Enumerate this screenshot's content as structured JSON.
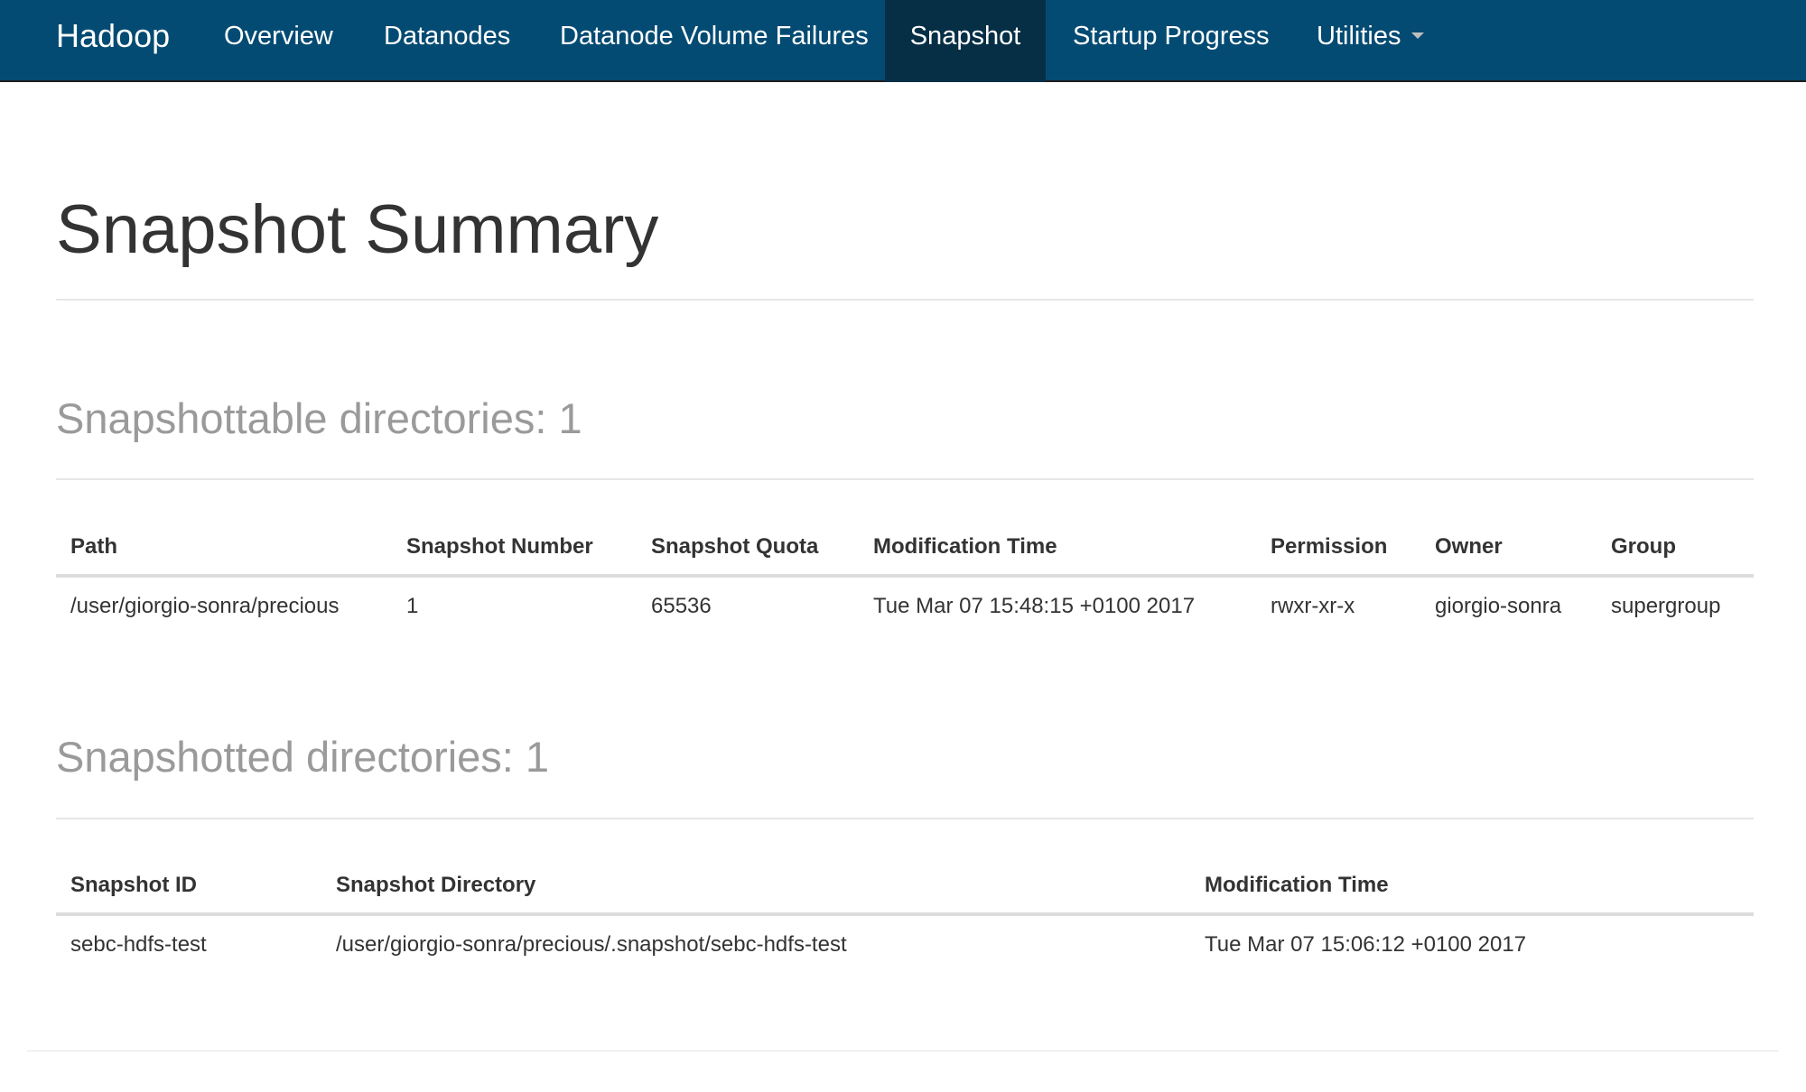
{
  "nav": {
    "brand": "Hadoop",
    "items": [
      {
        "label": "Overview"
      },
      {
        "label": "Datanodes"
      },
      {
        "label": "Datanode Volume Failures"
      },
      {
        "label": "Snapshot"
      },
      {
        "label": "Startup Progress"
      },
      {
        "label": "Utilities"
      }
    ],
    "active_item": "Snapshot",
    "colors": {
      "bar": "#044b73",
      "active": "#062f46"
    }
  },
  "page": {
    "title": "Snapshot Summary"
  },
  "snapshottable": {
    "title": "Snapshottable directories: 1",
    "columns": [
      "Path",
      "Snapshot Number",
      "Snapshot Quota",
      "Modification Time",
      "Permission",
      "Owner",
      "Group"
    ],
    "rows": [
      [
        "/user/giorgio-sonra/precious",
        "1",
        "65536",
        "Tue Mar 07 15:48:15 +0100 2017",
        "rwxr-xr-x",
        "giorgio-sonra",
        "supergroup"
      ]
    ]
  },
  "snapshotted": {
    "title": "Snapshotted directories: 1",
    "columns": [
      "Snapshot ID",
      "Snapshot Directory",
      "Modification Time"
    ],
    "rows": [
      [
        "sebc-hdfs-test",
        "/user/giorgio-sonra/precious/.snapshot/sebc-hdfs-test",
        "Tue Mar 07 15:06:12 +0100 2017"
      ]
    ]
  }
}
